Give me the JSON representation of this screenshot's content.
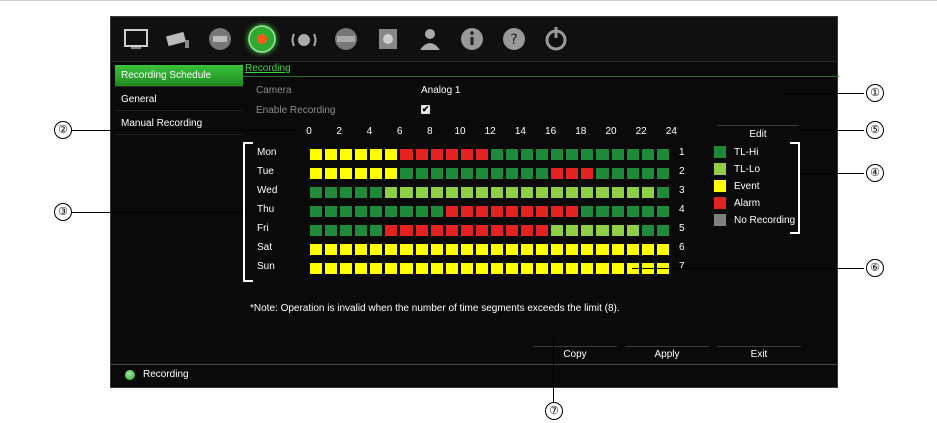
{
  "sidebar": {
    "items": [
      {
        "label": "Recording Schedule",
        "active": true
      },
      {
        "label": "General",
        "active": false
      },
      {
        "label": "Manual Recording",
        "active": false
      }
    ]
  },
  "toolbar": {
    "icons": [
      "display-icon",
      "camera-icon",
      "network-icon",
      "recording-icon",
      "alarm-icon",
      "device-icon",
      "storage-icon",
      "user-icon",
      "info-icon",
      "help-icon",
      "power-icon"
    ],
    "active_index": 3
  },
  "page": {
    "tab": "Recording",
    "camera_label": "Camera",
    "camera_value": "Analog 1",
    "enable_label": "Enable Recording",
    "enable_checked": true
  },
  "schedule": {
    "hours": [
      "0",
      "2",
      "4",
      "6",
      "8",
      "10",
      "12",
      "14",
      "16",
      "18",
      "20",
      "22",
      "24"
    ],
    "days": [
      {
        "name": "Mon",
        "segments": 1
      },
      {
        "name": "Tue",
        "segments": 2
      },
      {
        "name": "Wed",
        "segments": 3
      },
      {
        "name": "Thu",
        "segments": 4
      },
      {
        "name": "Fri",
        "segments": 5
      },
      {
        "name": "Sat",
        "segments": 6
      },
      {
        "name": "Sun",
        "segments": 7
      }
    ],
    "rows": [
      "YYYYYYRRRRRRGGGGGGGGGGGG",
      "YYYYYYGGGGGGGGGGRRRGGGGG",
      "GGGGGLLLLLLLLLLLLLLLLLLG",
      "GGGGGGGGGRRRRRRRRRGGGGGG",
      "GGGGGRRRRRRRRRRRLLLLLLGG",
      "YYYYYYYYYYYYYYYYYYYYYYYY",
      "YYYYYYYYYYYYYYYYYYYYYYYY"
    ],
    "colors": {
      "G": "#1e8a3a",
      "L": "#8ecf45",
      "Y": "#ffff00",
      "R": "#e42222",
      "N": "#808080"
    }
  },
  "legend": {
    "title": "Edit",
    "items": [
      {
        "label": "TL-Hi",
        "color": "#1e8a3a"
      },
      {
        "label": "TL-Lo",
        "color": "#8ecf45"
      },
      {
        "label": "Event",
        "color": "#ffff00"
      },
      {
        "label": "Alarm",
        "color": "#e42222"
      },
      {
        "label": "No Recording",
        "color": "#808080"
      }
    ]
  },
  "note": "*Note: Operation is invalid when the number of time segments exceeds the limit (8).",
  "buttons": {
    "copy": "Copy",
    "apply": "Apply",
    "exit": "Exit"
  },
  "status": {
    "text": "Recording"
  },
  "callouts": [
    "①",
    "②",
    "③",
    "④",
    "⑤",
    "⑥",
    "⑦"
  ]
}
